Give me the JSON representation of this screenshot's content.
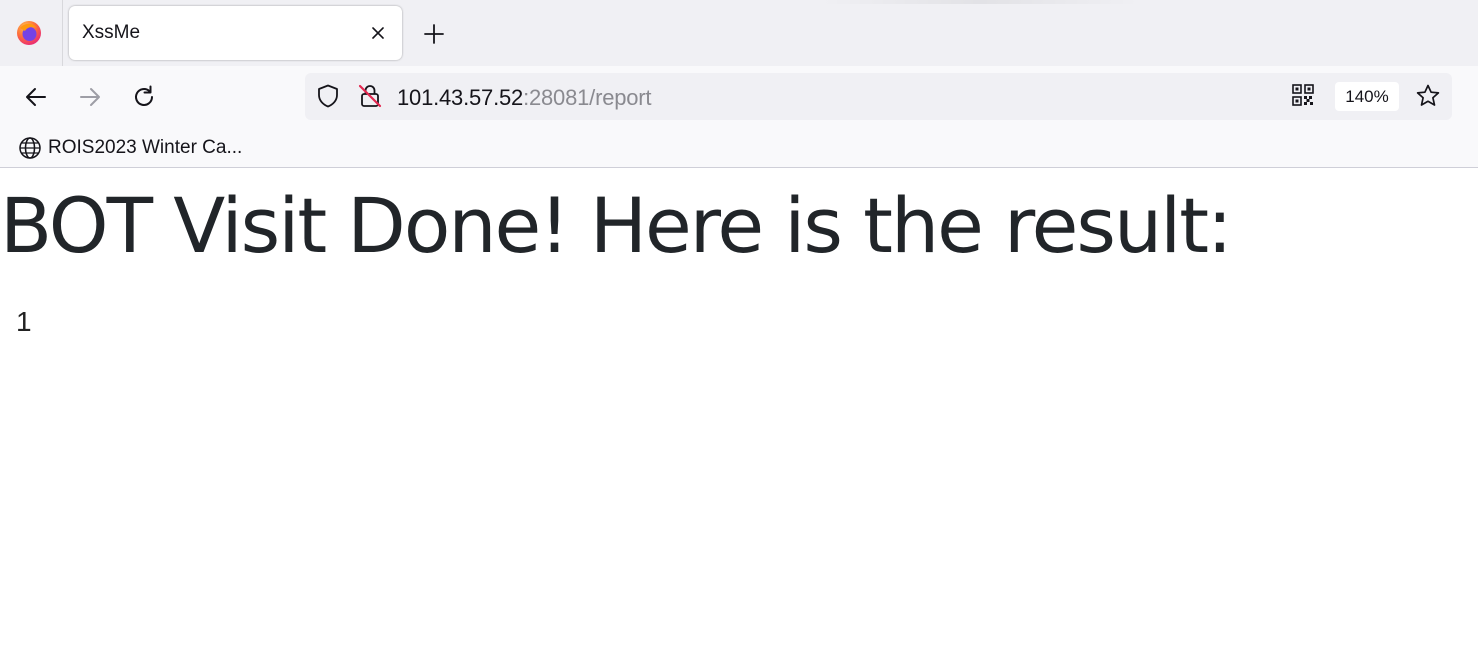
{
  "browser": {
    "tab": {
      "title": "XssMe"
    },
    "icons": {
      "logo": "firefox-icon",
      "close": "close-icon",
      "new_tab": "plus-icon",
      "back": "back-arrow-icon",
      "forward": "forward-arrow-icon",
      "reload": "reload-icon",
      "shield": "shield-icon",
      "insecure": "insecure-lock-icon",
      "qr": "qr-code-icon",
      "bookmark_star": "star-icon",
      "globe": "globe-icon"
    },
    "url": {
      "host": "101.43.57.52",
      "rest": ":28081/report"
    },
    "zoom": "140%",
    "bookmarks": [
      {
        "label": "ROIS2023 Winter Ca..."
      }
    ]
  },
  "page": {
    "heading": "BOT Visit Done! Here is the result:",
    "result": "1"
  },
  "colors": {
    "tabstrip_bg": "#f0f0f4",
    "toolbar_bg": "#f9f9fb",
    "heading_text": "#212529",
    "insecure_accent": "#e22850"
  }
}
